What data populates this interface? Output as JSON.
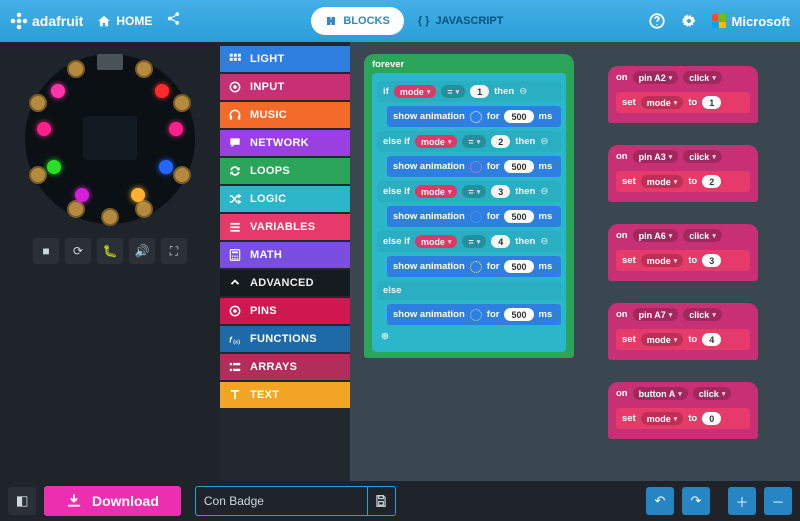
{
  "header": {
    "brand": "adafruit",
    "home": "HOME",
    "mode_blocks": "BLOCKS",
    "mode_js": "JAVASCRIPT",
    "microsoft": "Microsoft"
  },
  "toolbox": [
    {
      "label": "LIGHT",
      "color": "#2f7fe0",
      "icon": "grid"
    },
    {
      "label": "INPUT",
      "color": "#c73075",
      "icon": "target"
    },
    {
      "label": "MUSIC",
      "color": "#f26b2a",
      "icon": "headphones"
    },
    {
      "label": "NETWORK",
      "color": "#9a3fe0",
      "icon": "chat"
    },
    {
      "label": "LOOPS",
      "color": "#2aa55a",
      "icon": "loop"
    },
    {
      "label": "LOGIC",
      "color": "#2bb6c9",
      "icon": "shuffle"
    },
    {
      "label": "VARIABLES",
      "color": "#e63a6a",
      "icon": "bars"
    },
    {
      "label": "MATH",
      "color": "#7a4fe0",
      "icon": "calc"
    },
    {
      "label": "ADVANCED",
      "color": "adv",
      "icon": "chev"
    },
    {
      "label": "PINS",
      "color": "#cf1850",
      "icon": "target"
    },
    {
      "label": "FUNCTIONS",
      "color": "#1e6aa6",
      "icon": "fx"
    },
    {
      "label": "ARRAYS",
      "color": "#b22d5a",
      "icon": "list"
    },
    {
      "label": "TEXT",
      "color": "#f2a425",
      "icon": "text"
    }
  ],
  "forever_block": {
    "label": "forever",
    "branches": [
      {
        "kw": "if",
        "var": "mode",
        "op": "=",
        "val": "1",
        "then": "then",
        "anim": {
          "label": "show animation",
          "for": "for",
          "ms_val": "500",
          "ms": "ms",
          "color": "#ffffff"
        }
      },
      {
        "kw": "else if",
        "var": "mode",
        "op": "=",
        "val": "2",
        "then": "then",
        "anim": {
          "label": "show animation",
          "for": "for",
          "ms_val": "500",
          "ms": "ms",
          "color": "#ff6bd2"
        }
      },
      {
        "kw": "else if",
        "var": "mode",
        "op": "=",
        "val": "3",
        "then": "then",
        "anim": {
          "label": "show animation",
          "for": "for",
          "ms_val": "500",
          "ms": "ms",
          "color": "#4aa3ff"
        }
      },
      {
        "kw": "else if",
        "var": "mode",
        "op": "=",
        "val": "4",
        "then": "then",
        "anim": {
          "label": "show animation",
          "for": "for",
          "ms_val": "500",
          "ms": "ms",
          "color": "#ffe35a"
        }
      },
      {
        "kw": "else",
        "anim": {
          "label": "show animation",
          "for": "for",
          "ms_val": "500",
          "ms": "ms",
          "color": "#9fe0ff"
        }
      }
    ]
  },
  "events": [
    {
      "on": "on",
      "src": "pin A2",
      "act": "click",
      "set": "set",
      "var": "mode",
      "to": "to",
      "val": "1"
    },
    {
      "on": "on",
      "src": "pin A3",
      "act": "click",
      "set": "set",
      "var": "mode",
      "to": "to",
      "val": "2"
    },
    {
      "on": "on",
      "src": "pin A6",
      "act": "click",
      "set": "set",
      "var": "mode",
      "to": "to",
      "val": "3"
    },
    {
      "on": "on",
      "src": "pin A7",
      "act": "click",
      "set": "set",
      "var": "mode",
      "to": "to",
      "val": "4"
    },
    {
      "on": "on",
      "src": "button A",
      "act": "click",
      "set": "set",
      "var": "mode",
      "to": "to",
      "val": "0"
    }
  ],
  "bottom": {
    "download": "Download",
    "project_name": "Con Badge"
  },
  "colors": {
    "forever_hat": "#2aa55a",
    "if_block": "#2bb6c9",
    "show_anim": "#2f7fe0",
    "var_pill": "#e63a6a",
    "event_hat": "#c73075",
    "set_block": "#e63a6a"
  }
}
